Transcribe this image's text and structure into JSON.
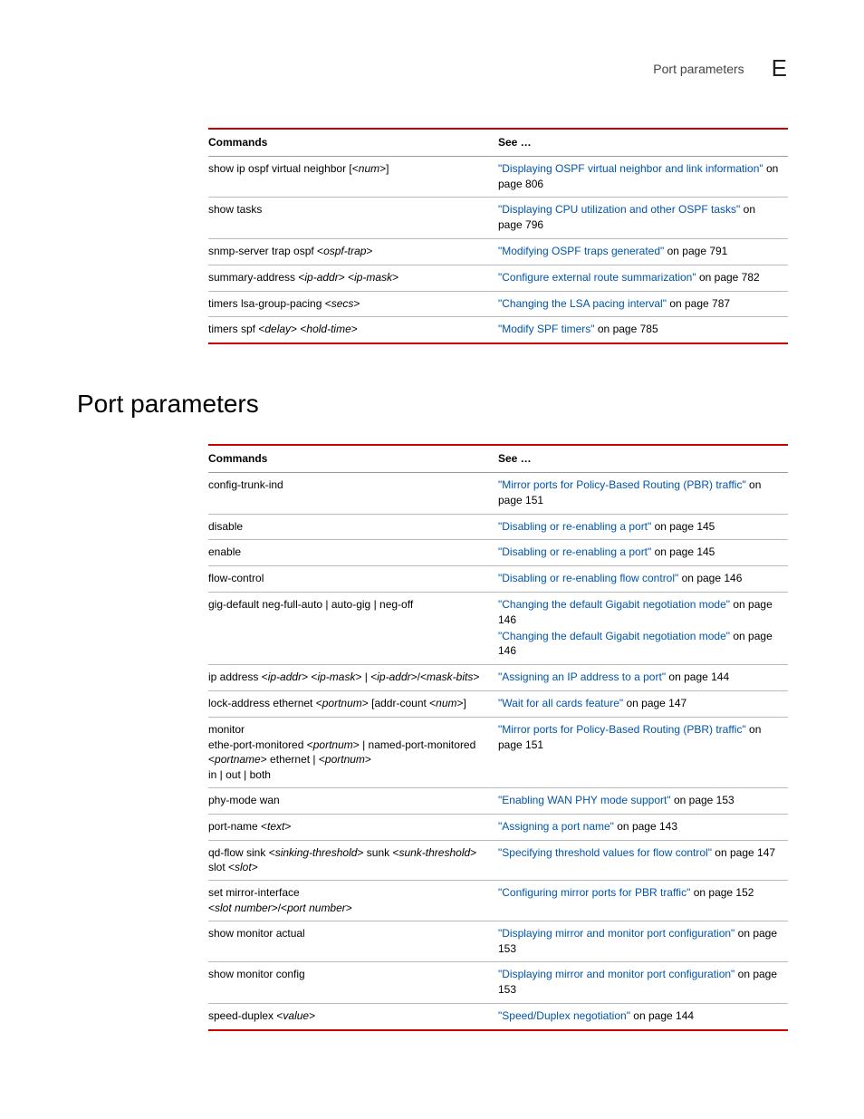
{
  "header": {
    "text": "Port parameters",
    "letter": "E"
  },
  "table1": {
    "headers": {
      "cmd": "Commands",
      "see": "See …"
    },
    "rows": [
      {
        "cmd_pre": "show ip ospf virtual neighbor [<",
        "cmd_it": "num",
        "cmd_post": ">]",
        "links": [
          {
            "title": "\"Displaying OSPF virtual neighbor and link information\"",
            "suffix": " on page 806"
          }
        ]
      },
      {
        "cmd_pre": "show tasks",
        "cmd_it": "",
        "cmd_post": "",
        "links": [
          {
            "title": "\"Displaying CPU utilization and other OSPF tasks\"",
            "suffix": " on page 796"
          }
        ]
      },
      {
        "cmd_pre": "snmp-server trap ospf <",
        "cmd_it": "ospf-trap",
        "cmd_post": ">",
        "links": [
          {
            "title": "\"Modifying OSPF traps generated\"",
            "suffix": " on page 791"
          }
        ]
      },
      {
        "cmd_pre": "summary-address <",
        "cmd_it": "ip-addr",
        "cmd_post": "> <",
        "cmd_it2": "ip-mask",
        "cmd_post2": ">",
        "links": [
          {
            "title": "\"Configure external route summarization\"",
            "suffix": " on page 782"
          }
        ]
      },
      {
        "cmd_pre": "timers lsa-group-pacing <",
        "cmd_it": "secs",
        "cmd_post": ">",
        "links": [
          {
            "title": "\"Changing the LSA pacing interval\"",
            "suffix": " on page 787"
          }
        ]
      },
      {
        "cmd_pre": "timers spf <",
        "cmd_it": "delay",
        "cmd_post": "> <",
        "cmd_it2": "hold-time",
        "cmd_post2": ">",
        "links": [
          {
            "title": "\"Modify SPF timers\"",
            "suffix": " on page 785"
          }
        ]
      }
    ]
  },
  "section_title": "Port parameters",
  "table2": {
    "headers": {
      "cmd": "Commands",
      "see": "See …"
    },
    "rows": [
      {
        "cmd_html": "config-trunk-ind",
        "links": [
          {
            "title": "\"Mirror ports for Policy-Based Routing (PBR) traffic\"",
            "suffix": " on page 151"
          }
        ]
      },
      {
        "cmd_html": "disable",
        "links": [
          {
            "title": "\"Disabling or re-enabling a port\"",
            "suffix": " on page 145"
          }
        ]
      },
      {
        "cmd_html": "enable",
        "links": [
          {
            "title": "\"Disabling or re-enabling a port\"",
            "suffix": " on page 145"
          }
        ]
      },
      {
        "cmd_html": "flow-control",
        "links": [
          {
            "title": "\"Disabling or re-enabling flow control\"",
            "suffix": " on page 146"
          }
        ]
      },
      {
        "cmd_html": "gig-default neg-full-auto | auto-gig | neg-off",
        "links": [
          {
            "title": "\"Changing the default Gigabit negotiation mode\"",
            "suffix": " on page 146"
          },
          {
            "title": "\"Changing the default Gigabit negotiation mode\"",
            "suffix": " on page 146"
          }
        ]
      },
      {
        "cmd_segments": [
          {
            "t": "ip address <",
            "i": false
          },
          {
            "t": "ip-addr",
            "i": true
          },
          {
            "t": "> <",
            "i": false
          },
          {
            "t": "ip-mask",
            "i": true
          },
          {
            "t": "> | <",
            "i": false
          },
          {
            "t": "ip-addr",
            "i": true
          },
          {
            "t": ">/<",
            "i": false
          },
          {
            "t": "mask-bits",
            "i": true
          },
          {
            "t": ">",
            "i": false
          }
        ],
        "links": [
          {
            "title": "\"Assigning an IP address to a port\"",
            "suffix": " on page 144"
          }
        ]
      },
      {
        "cmd_segments": [
          {
            "t": "lock-address ethernet <",
            "i": false
          },
          {
            "t": "portnum",
            "i": true
          },
          {
            "t": "> [addr-count <",
            "i": false
          },
          {
            "t": "num",
            "i": true
          },
          {
            "t": ">]",
            "i": false
          }
        ],
        "links": [
          {
            "title": "\"Wait for all cards feature\"",
            "suffix": " on page 147"
          }
        ]
      },
      {
        "cmd_segments": [
          {
            "t": "monitor",
            "i": false
          },
          {
            "t": "\n",
            "i": false
          },
          {
            "t": "ethe-port-monitored <",
            "i": false
          },
          {
            "t": "portnum",
            "i": true
          },
          {
            "t": "> | named-port-monitored <",
            "i": false
          },
          {
            "t": "portname",
            "i": true
          },
          {
            "t": "> ethernet | <",
            "i": false
          },
          {
            "t": "portnum",
            "i": true
          },
          {
            "t": ">",
            "i": false
          },
          {
            "t": "\n",
            "i": false
          },
          {
            "t": "in | out | both",
            "i": false
          }
        ],
        "links": [
          {
            "title": "\"Mirror ports for Policy-Based Routing (PBR) traffic\"",
            "suffix": " on page 151"
          }
        ]
      },
      {
        "cmd_html": "phy-mode wan",
        "links": [
          {
            "title": "\"Enabling WAN PHY mode support\"",
            "suffix": " on page 153"
          }
        ]
      },
      {
        "cmd_segments": [
          {
            "t": "port-name <",
            "i": false
          },
          {
            "t": "text",
            "i": true
          },
          {
            "t": ">",
            "i": false
          }
        ],
        "links": [
          {
            "title": "\"Assigning a port name\"",
            "suffix": " on page 143"
          }
        ]
      },
      {
        "cmd_segments": [
          {
            "t": "qd-flow sink <",
            "i": false
          },
          {
            "t": "sinking-threshold",
            "i": true
          },
          {
            "t": "> sunk <",
            "i": false
          },
          {
            "t": "sunk-threshold",
            "i": true
          },
          {
            "t": "> slot <",
            "i": false
          },
          {
            "t": "slot",
            "i": true
          },
          {
            "t": ">",
            "i": false
          }
        ],
        "links": [
          {
            "title": "\"Specifying threshold values for flow control\"",
            "suffix": " on page 147"
          }
        ]
      },
      {
        "cmd_segments": [
          {
            "t": "set mirror-interface",
            "i": false
          },
          {
            "t": "\n",
            "i": false
          },
          {
            "t": "<",
            "i": false
          },
          {
            "t": "slot number",
            "i": true
          },
          {
            "t": ">/<",
            "i": false
          },
          {
            "t": "port number",
            "i": true
          },
          {
            "t": ">",
            "i": false
          }
        ],
        "links": [
          {
            "title": "\"Configuring mirror ports for PBR traffic\"",
            "suffix": " on page 152"
          }
        ]
      },
      {
        "cmd_html": "show monitor actual",
        "links": [
          {
            "title": "\"Displaying mirror and monitor port configuration\"",
            "suffix": " on page 153"
          }
        ]
      },
      {
        "cmd_html": "show monitor config",
        "links": [
          {
            "title": "\"Displaying mirror and monitor port configuration\"",
            "suffix": " on page 153"
          }
        ]
      },
      {
        "cmd_segments": [
          {
            "t": "speed-duplex <",
            "i": false
          },
          {
            "t": "value",
            "i": true
          },
          {
            "t": ">",
            "i": false
          }
        ],
        "links": [
          {
            "title": "\"Speed/Duplex negotiation\"",
            "suffix": " on page 144"
          }
        ]
      }
    ]
  }
}
